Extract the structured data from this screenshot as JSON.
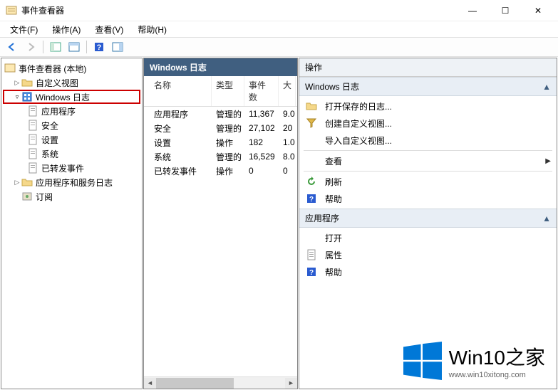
{
  "window": {
    "title": "事件查看器",
    "controls": {
      "min": "—",
      "max": "☐",
      "close": "✕"
    }
  },
  "menu": {
    "file": "文件(F)",
    "action": "操作(A)",
    "view": "查看(V)",
    "help": "帮助(H)"
  },
  "tree": {
    "root": "事件查看器 (本地)",
    "custom": "自定义视图",
    "winlog": "Windows 日志",
    "app": "应用程序",
    "security": "安全",
    "setup": "设置",
    "system": "系统",
    "forward": "已转发事件",
    "appsvc": "应用程序和服务日志",
    "subscribe": "订阅"
  },
  "center": {
    "title": "Windows 日志",
    "columns": {
      "name": "名称",
      "type": "类型",
      "count": "事件数",
      "size": "大"
    },
    "rows": [
      {
        "name": "应用程序",
        "type": "管理的",
        "count": "11,367",
        "size": "9.0"
      },
      {
        "name": "安全",
        "type": "管理的",
        "count": "27,102",
        "size": "20"
      },
      {
        "name": "设置",
        "type": "操作",
        "count": "182",
        "size": "1.0"
      },
      {
        "name": "系统",
        "type": "管理的",
        "count": "16,529",
        "size": "8.0"
      },
      {
        "name": "已转发事件",
        "type": "操作",
        "count": "0",
        "size": "0"
      }
    ]
  },
  "right": {
    "title": "操作",
    "section1": {
      "title": "Windows 日志",
      "open_saved": "打开保存的日志...",
      "create_view": "创建自定义视图...",
      "import_view": "导入自定义视图...",
      "view": "查看",
      "refresh": "刷新",
      "help": "帮助"
    },
    "section2": {
      "title": "应用程序",
      "open": "打开",
      "properties": "属性",
      "help": "帮助"
    }
  },
  "watermark": {
    "brand": "Win10之家",
    "url": "www.win10xitong.com"
  }
}
